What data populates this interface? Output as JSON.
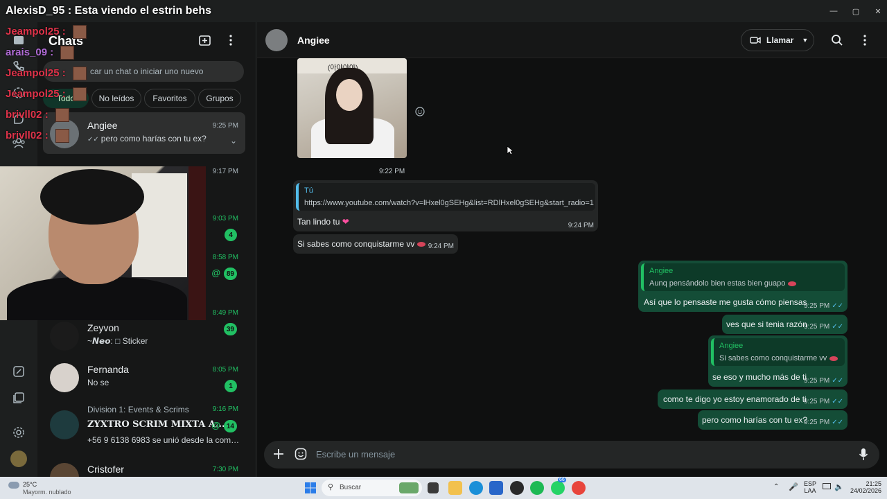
{
  "stream": {
    "title": "AlexisD_95 : Esta viendo el estrin behs",
    "chat_messages": [
      {
        "user": "Jeampol25",
        "color": "#e0334a"
      },
      {
        "user": "arais_09",
        "color": "#b06bd6"
      },
      {
        "user": "Jeampol25",
        "color": "#e0334a"
      },
      {
        "user": "Jeampol25",
        "color": "#e0334a"
      },
      {
        "user": "brivll02",
        "color": "#e0334a"
      },
      {
        "user": "brivll02",
        "color": "#e0334a"
      }
    ]
  },
  "sidebar": {
    "title": "Chats",
    "search_placeholder": "car un chat o iniciar uno nuevo",
    "filters": [
      "Todo",
      "No leídos",
      "Favoritos",
      "Grupos"
    ],
    "chats": [
      {
        "name": "Angiee",
        "preview": "pero como harías con tu ex?",
        "time": "9:25 PM",
        "ticks": "✓✓"
      },
      {
        "name": "",
        "preview": "",
        "time": "9:17 PM"
      },
      {
        "name": "",
        "preview": "",
        "time": "9:03 PM",
        "unread": "4"
      },
      {
        "name": "",
        "preview": "",
        "time": "8:58 PM",
        "unread": "89",
        "mention": "@"
      },
      {
        "name": "",
        "preview": "",
        "time": "8:49 PM"
      },
      {
        "name": "Zeyvon",
        "sender": "~𝙉𝙚𝙤:",
        "preview": "Sticker",
        "unread": "39"
      },
      {
        "name": "Fernanda",
        "preview": "No se",
        "time": "8:05 PM",
        "unread": "1"
      },
      {
        "name": "Division 1: Events & Scrims",
        "subtitle": "ZYXTRO SCRIM MIXTA A...",
        "preview": "+56 9 6138 6983 se unió desde la comu...",
        "time": "9:16 PM",
        "unread": "14",
        "mention": "@"
      },
      {
        "name": "Cristofer",
        "time": "7:30 PM"
      }
    ]
  },
  "conversation": {
    "contact": "Angiee",
    "call_label": "Llamar",
    "composer_placeholder": "Escribe un mensaje",
    "messages": [
      {
        "type": "image",
        "direction": "in",
        "image_caption": "(아야야야)",
        "time": "9:22 PM"
      },
      {
        "type": "text",
        "direction": "in",
        "quote_author": "Tú",
        "quote_text": "https://www.youtube.com/watch?v=lHxel0gSEHg&list=RDlHxel0gSEHg&start_radio=1",
        "text": "Tan lindo tu",
        "time": "9:24 PM"
      },
      {
        "type": "text",
        "direction": "in",
        "text": "Si sabes como conquistarme vv",
        "time": "9:24 PM"
      },
      {
        "type": "text",
        "direction": "out",
        "quote_author": "Angiee",
        "quote_text": "Aunq pensándolo bien estas bien guapo",
        "text": "Así que lo pensaste me gusta cómo piensas",
        "time": "9:25 PM"
      },
      {
        "type": "text",
        "direction": "out",
        "text": "ves que si tenia razón",
        "time": "9:25 PM"
      },
      {
        "type": "text",
        "direction": "out",
        "quote_author": "Angiee",
        "quote_text": "Si sabes como conquistarme vv",
        "text": "se eso y mucho más de ti",
        "time": "9:25 PM"
      },
      {
        "type": "text",
        "direction": "out",
        "text": "como te digo yo estoy enamorado de ti",
        "time": "9:25 PM"
      },
      {
        "type": "text",
        "direction": "out",
        "text": "pero como harías con tu ex?",
        "time": "9:25 PM"
      }
    ]
  },
  "taskbar": {
    "weather_temp": "25°C",
    "weather_desc": "Mayorm. nublado",
    "search_label": "Buscar",
    "whatsapp_badge": "66",
    "lang": "ESP",
    "lang_region": "LAA",
    "clock_time": "21:25",
    "clock_date": "24/02/2026"
  },
  "colors": {
    "accent": "#21c063",
    "bubble_out": "#144d37",
    "bubble_in": "#242626",
    "read_ticks": "#53bdeb"
  }
}
